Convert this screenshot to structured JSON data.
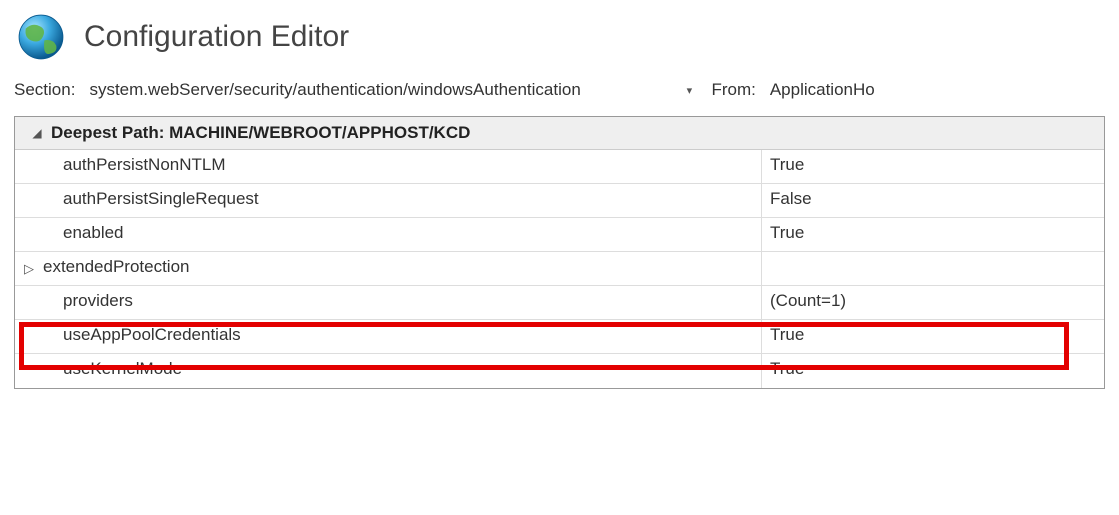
{
  "header": {
    "title": "Configuration Editor"
  },
  "section": {
    "label": "Section:",
    "value": "system.webServer/security/authentication/windowsAuthentication",
    "from_label": "From:",
    "from_value": "ApplicationHo"
  },
  "grid": {
    "header": {
      "prefix": "Deepest Path:",
      "path": "MACHINE/WEBROOT/APPHOST/KCD"
    },
    "rows": [
      {
        "name": "authPersistNonNTLM",
        "value": "True",
        "expandable": false
      },
      {
        "name": "authPersistSingleRequest",
        "value": "False",
        "expandable": false
      },
      {
        "name": "enabled",
        "value": "True",
        "expandable": false
      },
      {
        "name": "extendedProtection",
        "value": "",
        "expandable": true
      },
      {
        "name": "providers",
        "value": "(Count=1)",
        "expandable": false
      },
      {
        "name": "useAppPoolCredentials",
        "value": "True",
        "expandable": false
      },
      {
        "name": "useKernelMode",
        "value": "True",
        "expandable": false
      }
    ]
  }
}
